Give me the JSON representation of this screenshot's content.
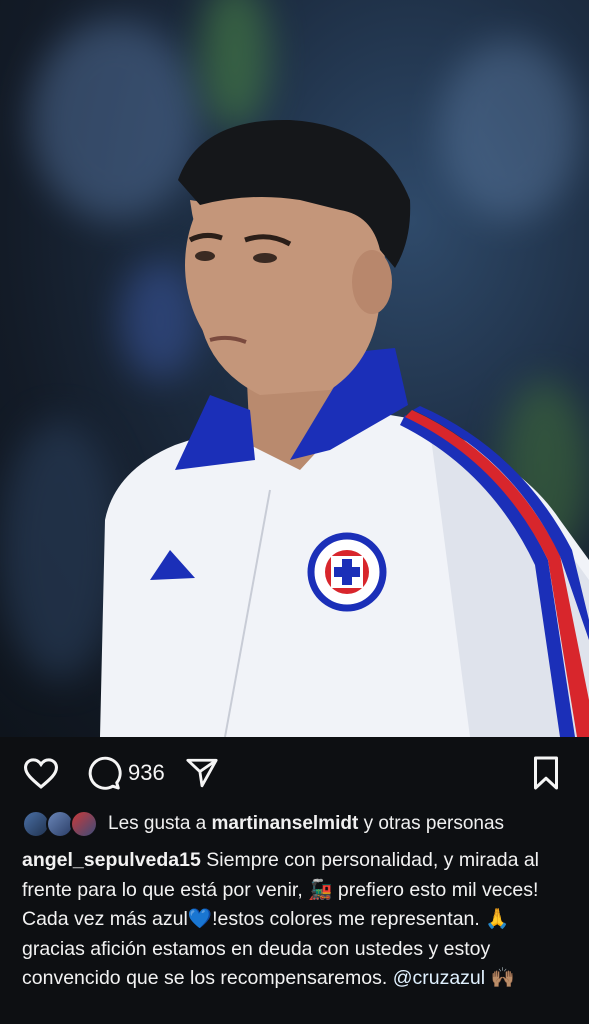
{
  "post": {
    "image_alt": "player-photo",
    "comment_count": "936"
  },
  "likes": {
    "prefix": "Les gusta a",
    "user": "martinanselmidt",
    "suffix": "y otras personas"
  },
  "caption": {
    "username": "angel_sepulveda15",
    "text_1": " Siempre con personalidad, y mirada al frente para lo que está por venir, ",
    "emoji_1": "🚂",
    "text_2": " prefiero esto mil veces! Cada vez más azul",
    "emoji_2": "💙",
    "text_3": "!estos colores me representan. ",
    "emoji_3": "🙏",
    "text_4": " gracias afición estamos en deuda con ustedes y estoy convencido que se los recompensaremos. ",
    "mention": "@cruzazul",
    "emoji_4": "🙌🏽"
  },
  "colors": {
    "background": "#0d0f12",
    "jacket": "#f4f6fb",
    "collar": "#1b2fb8",
    "stripe_red": "#d8262c"
  },
  "icons": [
    "heart-icon",
    "comment-icon",
    "share-icon",
    "bookmark-icon"
  ]
}
